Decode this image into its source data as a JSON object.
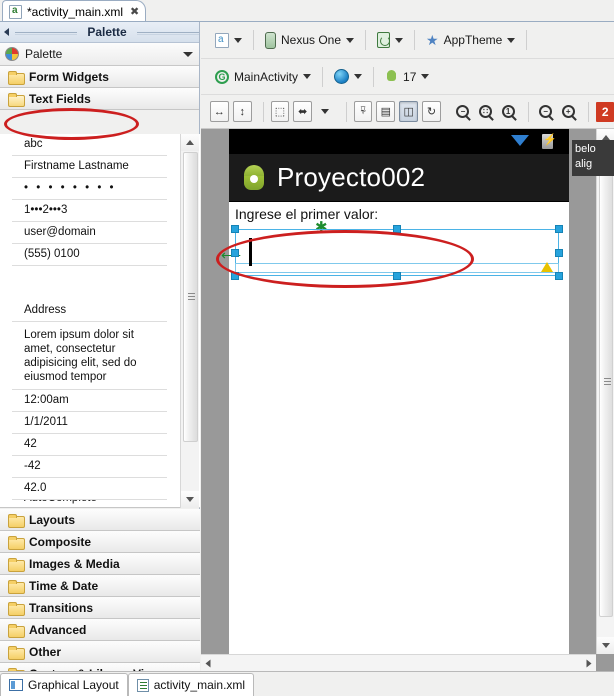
{
  "editor_tab": {
    "title": "*activity_main.xml",
    "close_label": "✖",
    "icon": "xml-file-icon"
  },
  "palette_panel": {
    "title": "Palette",
    "collapse_icon": "left-arrow-icon",
    "header": {
      "label": "Palette",
      "icon": "palette-disc-icon",
      "menu_icon": "chevron-down-icon"
    },
    "categories_top": [
      {
        "label": "Form Widgets",
        "icon": "folder-icon",
        "open": false
      },
      {
        "label": "Text Fields",
        "icon": "folder-open-icon",
        "open": true
      }
    ],
    "widgets": [
      {
        "label": "abc",
        "kind": "plain-text",
        "highlighted": true
      },
      {
        "label": "Firstname Lastname",
        "kind": "person-name"
      },
      {
        "label": "• • • • • • • •",
        "kind": "password"
      },
      {
        "label": "1•••2•••3",
        "kind": "password-numeric"
      },
      {
        "label": "user@domain",
        "kind": "email"
      },
      {
        "label": "(555) 0100",
        "kind": "phone"
      },
      {
        "label": "Address",
        "kind": "postal-address"
      },
      {
        "label": "Lorem ipsum dolor sit amet, consectetur adipisicing elit, sed do eiusmod tempor",
        "kind": "multiline-text"
      },
      {
        "label": "12:00am",
        "kind": "time"
      },
      {
        "label": "1/1/2011",
        "kind": "date"
      },
      {
        "label": "42",
        "kind": "number"
      },
      {
        "label": "-42",
        "kind": "number-signed"
      },
      {
        "label": "42.0",
        "kind": "number-decimal"
      },
      {
        "label": "AutoComplete",
        "kind": "autocomplete",
        "clipped": true
      }
    ],
    "scrollbar": {
      "up_icon": "scroll-up-arrow-icon",
      "down_icon": "scroll-down-arrow-icon"
    },
    "categories_bottom": [
      {
        "label": "Layouts",
        "icon": "folder-icon"
      },
      {
        "label": "Composite",
        "icon": "folder-icon"
      },
      {
        "label": "Images & Media",
        "icon": "folder-icon"
      },
      {
        "label": "Time & Date",
        "icon": "folder-icon"
      },
      {
        "label": "Transitions",
        "icon": "folder-icon"
      },
      {
        "label": "Advanced",
        "icon": "folder-icon"
      },
      {
        "label": "Other",
        "icon": "folder-icon"
      },
      {
        "label": "Custom & Library Views",
        "icon": "folder-icon"
      }
    ]
  },
  "toolbar_row1": {
    "config_icon": "xml-config-icon",
    "device": {
      "label": "Nexus One",
      "icon": "device-icon"
    },
    "orientation_icon": "screen-rotate-icon",
    "theme": {
      "label": "AppTheme",
      "icon": "star-icon"
    },
    "dropdown_icon": "caret-down-icon"
  },
  "toolbar_row2": {
    "activity": {
      "label": "MainActivity",
      "icon": "activity-g-icon"
    },
    "locale_icon": "globe-icon",
    "api": {
      "label": "17",
      "icon": "android-icon"
    }
  },
  "toolbar_row3": {
    "buttons": [
      {
        "name": "match-width-button",
        "glyph": "↔"
      },
      {
        "name": "match-height-button",
        "glyph": "↕"
      },
      {
        "name": "show-outline-button",
        "glyph": "⬚"
      },
      {
        "name": "show-included-button",
        "glyph": "⬌"
      },
      {
        "name": "distribute-dropdown",
        "glyph": "▾"
      },
      {
        "name": "align-left-button",
        "glyph": "⌸"
      },
      {
        "name": "align-center-button",
        "glyph": "☰"
      },
      {
        "name": "align-selected-button",
        "glyph": "◳",
        "pressed": true
      },
      {
        "name": "refresh-layout-button",
        "glyph": "↻"
      }
    ],
    "zoom_fit": {
      "name": "zoom-fit-button",
      "glyph": "−"
    },
    "zoom_actual_fit": {
      "name": "zoom-fit-selection-button",
      "glyph": "⁙"
    },
    "zoom_100": {
      "name": "zoom-100-button",
      "glyph": "1"
    },
    "zoom_out": {
      "name": "zoom-out-button",
      "glyph": "−"
    },
    "zoom_in": {
      "name": "zoom-in-button",
      "glyph": "+"
    },
    "error_badge": {
      "label": "2",
      "color": "#cf3a22"
    }
  },
  "device_preview": {
    "app_title": "Proyecto002",
    "app_icon": "android-robot-icon",
    "status_icons": [
      "wifi-icon",
      "battery-charging-icon"
    ],
    "hint_label": "Ingrese el primer valor:",
    "selected_widget": {
      "name": "edit-text-widget",
      "value": "",
      "has_warning": true,
      "warning_icon": "warning-triangle-icon"
    }
  },
  "tooltip": {
    "line1": "belo",
    "line2": "alig"
  },
  "bottom_tabs": [
    {
      "label": "Graphical Layout",
      "icon": "graphical-layout-icon",
      "active": true
    },
    {
      "label": "activity_main.xml",
      "icon": "xml-source-icon",
      "active": false
    }
  ],
  "colors": {
    "selection": "#26a3dd",
    "annotation": "#cc1f1f",
    "error_badge": "#cf3a22",
    "android_green": "#a4c639"
  }
}
